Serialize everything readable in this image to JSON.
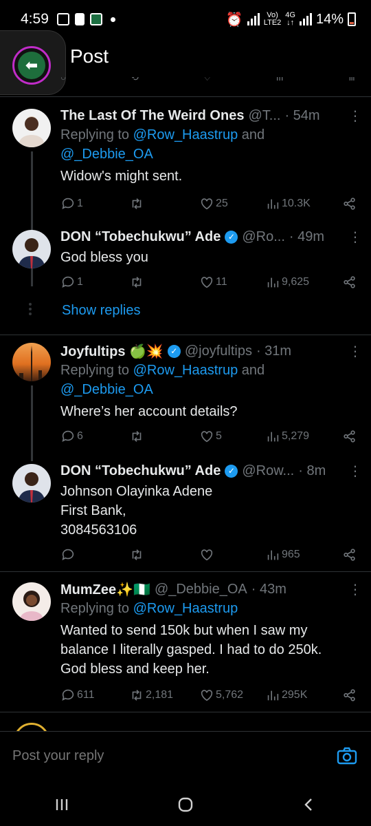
{
  "status_bar": {
    "time": "4:59",
    "net_top": "Vo)",
    "net_bottom": "LTE2",
    "gen": "4G",
    "battery": "14%"
  },
  "header": {
    "title": "Post"
  },
  "tweets": [
    {
      "name": "The Last Of The Weird Ones",
      "handle": "@T...",
      "time": "· 54m",
      "reply_prefix": "Replying to ",
      "reply_to_1": "@Row_Haastrup",
      "reply_and": " and",
      "reply_to_2": "@_Debbie_OA",
      "text": "Widow's might sent.",
      "replies": "1",
      "retweets": "",
      "likes": "25",
      "views": "10.3K"
    },
    {
      "name": "DON “Tobechukwu” Ade",
      "handle": "@Ro...",
      "time": "· 49m",
      "text": "God bless you",
      "replies": "1",
      "retweets": "",
      "likes": "11",
      "views": "9,625"
    },
    {
      "name": "Joyfultips 🍏💥",
      "handle": "@joyfultips",
      "time": "· 31m",
      "reply_prefix": "Replying to ",
      "reply_to_1": "@Row_Haastrup",
      "reply_and": " and",
      "reply_to_2": "@_Debbie_OA",
      "text": "Where’s her account details?",
      "replies": "6",
      "retweets": "",
      "likes": "5",
      "views": "5,279"
    },
    {
      "name": "DON “Tobechukwu” Ade",
      "handle": "@Row...",
      "time": "· 8m",
      "text_lines": [
        "Johnson Olayinka Adene",
        "First Bank,",
        "3084563106"
      ],
      "replies": "",
      "retweets": "",
      "likes": "",
      "views": "965"
    },
    {
      "name": "MumZee✨🇳🇬",
      "handle": "@_Debbie_OA",
      "time": "· 43m",
      "reply_prefix": "Replying to ",
      "reply_to_1": "@Row_Haastrup",
      "text_lines": [
        "Wanted to send 150k but when I saw my",
        "balance I literally gasped. I had to do 250k.",
        "God bless and keep her."
      ],
      "replies": "611",
      "retweets": "2,181",
      "likes": "5,762",
      "views": "295K"
    }
  ],
  "show_replies": "Show replies",
  "reply_bar": {
    "placeholder": "Post your reply"
  },
  "colors": {
    "accent": "#1d9bf0",
    "muted": "#71767b",
    "text": "#e7e9ea",
    "bg": "#000000"
  }
}
